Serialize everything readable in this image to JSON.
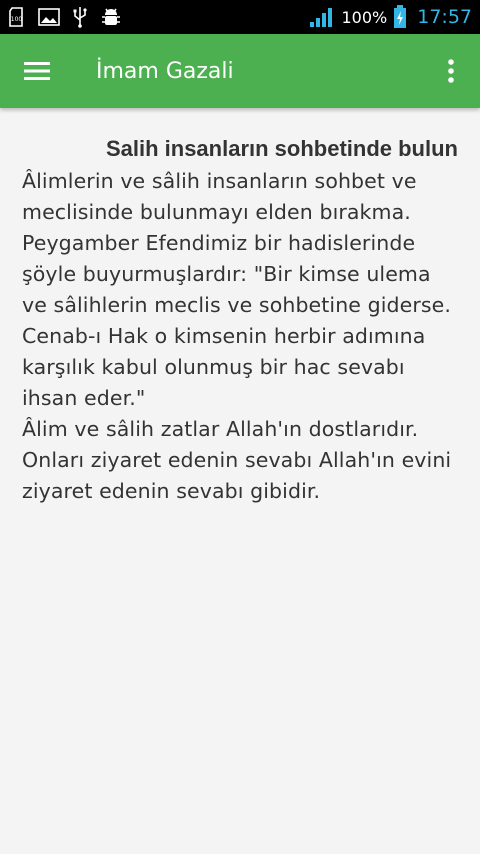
{
  "status_bar": {
    "icons": [
      "sd-card-icon",
      "image-icon",
      "usb-icon",
      "android-debug-icon"
    ],
    "battery_percent": "100%",
    "time": "17:57",
    "colors": {
      "clock": "#33b5e5",
      "background": "#000000"
    }
  },
  "app_bar": {
    "title": "İmam Gazali",
    "menu_icon": "hamburger-menu-icon",
    "overflow_icon": "more-vert-icon",
    "color": "#4caf50"
  },
  "article": {
    "title": "Salih insanların sohbetinde bulun",
    "body": "Âlimlerin ve sâlih insanların sohbet ve meclisinde bulunmayı elden bırakma. Peygamber Efendimiz bir hadislerinde şöyle buyurmuşlardır: \"Bir kimse ulema ve sâlihlerin meclis ve sohbetine giderse. Cenab-ı Hak o kimsenin herbir adımına karşılık kabul olunmuş bir hac sevabı ihsan eder.\"\nÂlim ve sâlih zatlar Allah'ın dostlarıdır. Onları ziyaret edenin sevabı Allah'ın evini ziyaret edenin sevabı gibidir."
  }
}
